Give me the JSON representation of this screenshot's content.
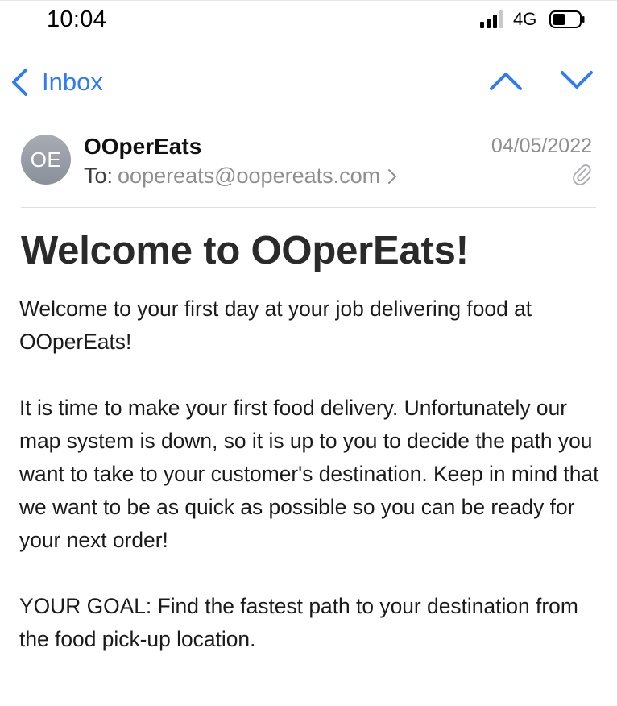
{
  "status_bar": {
    "time": "10:04",
    "network": "4G",
    "signal_icon": "cellular-signal-icon",
    "battery_icon": "battery-icon",
    "battery_level": 0.5
  },
  "nav": {
    "back_label": "Inbox",
    "back_icon": "chevron-left-icon",
    "prev_icon": "chevron-up-icon",
    "next_icon": "chevron-down-icon",
    "accent_color": "#2f7bf5"
  },
  "header": {
    "avatar_initials": "OE",
    "sender": "OOperEats",
    "date": "04/05/2022",
    "to_prefix": "To:",
    "to_address": "oopereats@oopereats.com",
    "attachment_icon": "paperclip-icon"
  },
  "message": {
    "subject": "Welcome to OOperEats!",
    "paragraphs": [
      "Welcome to your first day at your job delivering food at OOperEats!",
      "It is time to make your first food delivery. Unfortunately our map system is down, so it is up to you to decide the path you want to take to your customer's destination. Keep in mind that we want to be as quick as possible so you can be ready for your next order!",
      "YOUR GOAL: Find the fastest path to your destination from the food pick-up location."
    ]
  }
}
